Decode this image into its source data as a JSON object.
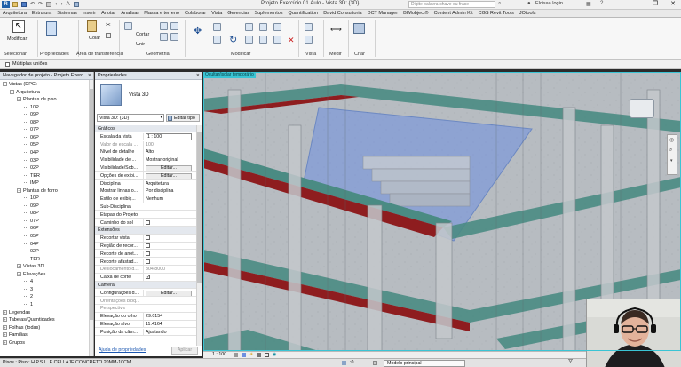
{
  "titlebar": {
    "title": "Projeto Exercício 01.Aulo - Vista 3D: {3D}",
    "search_placeholder": "Digite palavra-chave ou frase",
    "user": "Elcisaa login"
  },
  "tabs": [
    "Arquitetura",
    "Estrutura",
    "Sistemas",
    "Inserir",
    "Anotar",
    "Analisar",
    "Massa e terreno",
    "Colaborar",
    "Vista",
    "Gerenciar",
    "Suplementos",
    "Quantification",
    "David Consultoria",
    "DCT Manager",
    "BIMobject®",
    "Content Admin Kit",
    "CGS Revit Tools",
    "JOtools"
  ],
  "ribbon": {
    "modify_label": "Modificar",
    "paste_label": "Colar",
    "cut_label": "Cortar",
    "join_label": "Unir",
    "panels": [
      "Selecionar",
      "Propriedades",
      "Área de transferência",
      "Geometria",
      "Modificar",
      "Vista",
      "Medir",
      "Criar"
    ]
  },
  "selection_bar": {
    "multiple_label": "Múltiplas uniões"
  },
  "project_browser": {
    "title": "Navegador de projeto - Projeto Exerc...",
    "items": [
      {
        "label": "Vistas (DPC)",
        "indent": 0,
        "toggle": "−"
      },
      {
        "label": "Arquitetura",
        "indent": 1,
        "toggle": "−"
      },
      {
        "label": "Plantas de piso",
        "indent": 2,
        "toggle": "−"
      },
      {
        "label": "10P",
        "indent": 3,
        "toggle": ""
      },
      {
        "label": "09P",
        "indent": 3,
        "toggle": ""
      },
      {
        "label": "08P",
        "indent": 3,
        "toggle": ""
      },
      {
        "label": "07P",
        "indent": 3,
        "toggle": ""
      },
      {
        "label": "06P",
        "indent": 3,
        "toggle": ""
      },
      {
        "label": "05P",
        "indent": 3,
        "toggle": ""
      },
      {
        "label": "04P",
        "indent": 3,
        "toggle": ""
      },
      {
        "label": "03P",
        "indent": 3,
        "toggle": ""
      },
      {
        "label": "02P",
        "indent": 3,
        "toggle": ""
      },
      {
        "label": "TER",
        "indent": 3,
        "toggle": ""
      },
      {
        "label": "IMP",
        "indent": 3,
        "toggle": ""
      },
      {
        "label": "Plantas de forro",
        "indent": 2,
        "toggle": "−"
      },
      {
        "label": "10P",
        "indent": 3,
        "toggle": ""
      },
      {
        "label": "09P",
        "indent": 3,
        "toggle": ""
      },
      {
        "label": "08P",
        "indent": 3,
        "toggle": ""
      },
      {
        "label": "07P",
        "indent": 3,
        "toggle": ""
      },
      {
        "label": "06P",
        "indent": 3,
        "toggle": ""
      },
      {
        "label": "05P",
        "indent": 3,
        "toggle": ""
      },
      {
        "label": "04P",
        "indent": 3,
        "toggle": ""
      },
      {
        "label": "02P",
        "indent": 3,
        "toggle": ""
      },
      {
        "label": "TER",
        "indent": 3,
        "toggle": ""
      },
      {
        "label": "Vistas 3D",
        "indent": 2,
        "toggle": "+"
      },
      {
        "label": "Elevações",
        "indent": 2,
        "toggle": "−"
      },
      {
        "label": "4",
        "indent": 3,
        "toggle": ""
      },
      {
        "label": "3",
        "indent": 3,
        "toggle": ""
      },
      {
        "label": "2",
        "indent": 3,
        "toggle": ""
      },
      {
        "label": "1",
        "indent": 3,
        "toggle": ""
      },
      {
        "label": "Legendas",
        "indent": 0,
        "toggle": "+"
      },
      {
        "label": "Tabelas/Quantidades",
        "indent": 0,
        "toggle": "+"
      },
      {
        "label": "Folhas (todas)",
        "indent": 0,
        "toggle": "+"
      },
      {
        "label": "Famílias",
        "indent": 0,
        "toggle": "+"
      },
      {
        "label": "Grupos",
        "indent": 0,
        "toggle": "+"
      }
    ]
  },
  "properties": {
    "title": "Propriedades",
    "type_name": "Vista 3D",
    "selector_value": "Vista 3D: {3D}",
    "edit_type": "Editar tipo",
    "rows": [
      {
        "kind": "group",
        "k": "Gráficos"
      },
      {
        "kind": "row",
        "k": "Escala da vista",
        "v": "1 : 100",
        "box": true
      },
      {
        "kind": "row",
        "k": "Valor de escala ...",
        "v": "100",
        "gray": true
      },
      {
        "kind": "row",
        "k": "Nível de detalhe",
        "v": "Alto"
      },
      {
        "kind": "row",
        "k": "Visibilidade de ...",
        "v": "Mostrar original"
      },
      {
        "kind": "row",
        "k": "Visibilidade/Sob...",
        "v": "Editar...",
        "button": true
      },
      {
        "kind": "row",
        "k": "Opções de exibi...",
        "v": "Editar...",
        "button": true
      },
      {
        "kind": "row",
        "k": "Disciplina",
        "v": "Arquitetura"
      },
      {
        "kind": "row",
        "k": "Mostrar linhas o...",
        "v": "Por disciplina"
      },
      {
        "kind": "row",
        "k": "Estilo de exibiç...",
        "v": "Nenhum"
      },
      {
        "kind": "row",
        "k": "Sub-Disciplina",
        "v": ""
      },
      {
        "kind": "row",
        "k": "Etapas do Projeto",
        "v": ""
      },
      {
        "kind": "row",
        "k": "Caminho do sol",
        "v": "",
        "check": false
      },
      {
        "kind": "group",
        "k": "Extensões"
      },
      {
        "kind": "row",
        "k": "Recortar vista",
        "v": "",
        "check": false
      },
      {
        "kind": "row",
        "k": "Região de recor...",
        "v": "",
        "check": false
      },
      {
        "kind": "row",
        "k": "Recorte de anot...",
        "v": "",
        "check": false
      },
      {
        "kind": "row",
        "k": "Recorte afastad...",
        "v": "",
        "check": false
      },
      {
        "kind": "row",
        "k": "Deslocamento d...",
        "v": "304.8000",
        "gray": true
      },
      {
        "kind": "row",
        "k": "Caixa de corte",
        "v": "",
        "check": true
      },
      {
        "kind": "group",
        "k": "Câmera"
      },
      {
        "kind": "row",
        "k": "Configurações d...",
        "v": "Editar...",
        "button": true
      },
      {
        "kind": "row",
        "k": "Orientações bloq...",
        "v": "",
        "gray": true
      },
      {
        "kind": "row",
        "k": "Perspectiva",
        "v": "",
        "gray": true
      },
      {
        "kind": "row",
        "k": "Elevação do olho",
        "v": "29.0154"
      },
      {
        "kind": "row",
        "k": "Elevação alvo",
        "v": "11.4164"
      },
      {
        "kind": "row",
        "k": "Posição da câm...",
        "v": "Ajustando"
      }
    ],
    "help_link": "Ajuda de propriedades",
    "apply": "Aplicar"
  },
  "viewport": {
    "title": "Ocultar/isolar temporário",
    "scale": "1 : 100"
  },
  "statusbar": {
    "text": "Pisos : Piso : H.P.S.L. E CEI LAJE CONCRETO 20MM-10CM",
    "model": "Modelo principal",
    "zero": ":0"
  },
  "colors": {
    "accent": "#3ac4d4",
    "slab_top": "#b6bcc1",
    "beam_red": "#8e1d1f",
    "beam_green": "#4a8b83",
    "selection_blue": "#6e8fe0"
  }
}
